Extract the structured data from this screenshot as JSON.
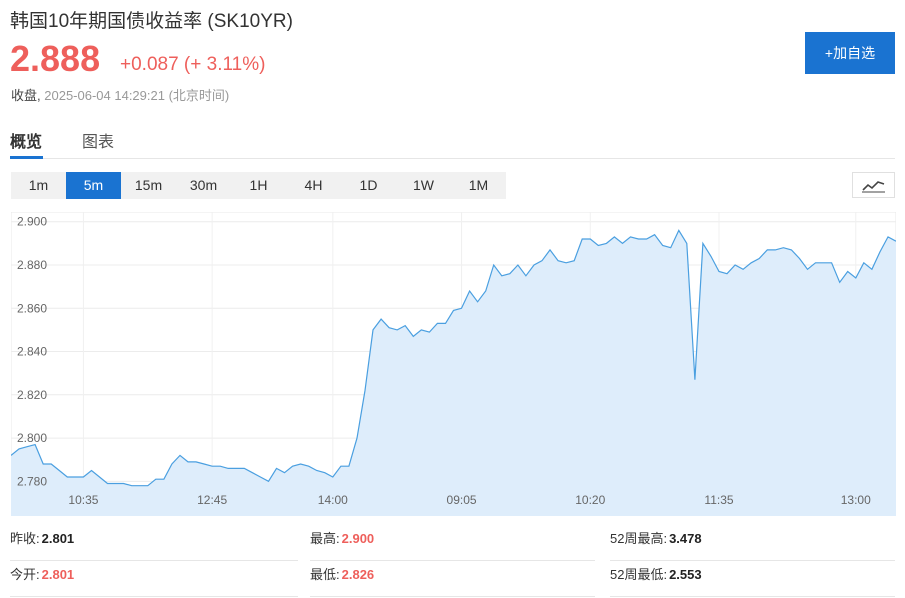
{
  "header": {
    "title": "韩国10年期国债收益率",
    "symbol": "(SK10YR)",
    "price": "2.888",
    "change": "+0.087 (+ 3.11%)",
    "status_label": "收盘,",
    "status_time": "2025-06-04 14:29:21 (北京时间)",
    "add_button": "+加自选",
    "price_color": "#ee5f5b",
    "accent_color": "#1a73d1"
  },
  "tabs": [
    {
      "label": "概览",
      "active": true
    },
    {
      "label": "图表",
      "active": false
    }
  ],
  "periods": [
    {
      "label": "1m",
      "active": false
    },
    {
      "label": "5m",
      "active": true
    },
    {
      "label": "15m",
      "active": false
    },
    {
      "label": "30m",
      "active": false
    },
    {
      "label": "1H",
      "active": false
    },
    {
      "label": "4H",
      "active": false
    },
    {
      "label": "1D",
      "active": false
    },
    {
      "label": "1W",
      "active": false
    },
    {
      "label": "1M",
      "active": false
    }
  ],
  "chart_toggle_icon": "line-chart-icon",
  "chart_data": {
    "type": "area",
    "y_ticks": [
      "2.900",
      "2.880",
      "2.860",
      "2.840",
      "2.820",
      "2.800",
      "2.780"
    ],
    "ylim": [
      2.776,
      2.9045
    ],
    "x_tick_labels": [
      {
        "label": "10:35",
        "index": 9
      },
      {
        "label": "12:45",
        "index": 25
      },
      {
        "label": "14:00",
        "index": 40
      },
      {
        "label": "09:05",
        "index": 56
      },
      {
        "label": "10:20",
        "index": 72
      },
      {
        "label": "11:35",
        "index": 88
      },
      {
        "label": "13:00",
        "index": 105
      }
    ],
    "values": [
      2.792,
      2.795,
      2.796,
      2.797,
      2.788,
      2.788,
      2.785,
      2.782,
      2.782,
      2.782,
      2.785,
      2.782,
      2.779,
      2.779,
      2.779,
      2.778,
      2.778,
      2.778,
      2.781,
      2.781,
      2.788,
      2.792,
      2.789,
      2.789,
      2.788,
      2.787,
      2.787,
      2.786,
      2.786,
      2.786,
      2.784,
      2.782,
      2.78,
      2.786,
      2.784,
      2.787,
      2.788,
      2.787,
      2.785,
      2.784,
      2.782,
      2.787,
      2.787,
      2.8,
      2.822,
      2.85,
      2.855,
      2.851,
      2.85,
      2.852,
      2.847,
      2.85,
      2.849,
      2.853,
      2.853,
      2.859,
      2.86,
      2.868,
      2.863,
      2.868,
      2.88,
      2.875,
      2.876,
      2.88,
      2.875,
      2.88,
      2.882,
      2.887,
      2.882,
      2.881,
      2.882,
      2.892,
      2.892,
      2.889,
      2.89,
      2.893,
      2.89,
      2.893,
      2.892,
      2.892,
      2.894,
      2.889,
      2.888,
      2.896,
      2.89,
      2.827,
      2.89,
      2.884,
      2.877,
      2.876,
      2.88,
      2.878,
      2.881,
      2.883,
      2.887,
      2.887,
      2.888,
      2.887,
      2.883,
      2.878,
      2.881,
      2.881,
      2.881,
      2.872,
      2.877,
      2.874,
      2.881,
      2.878,
      2.886,
      2.893,
      2.891
    ],
    "line_color": "#4a9fe0",
    "fill_color": "#deedfb",
    "grid": true
  },
  "stats": [
    {
      "key": "昨收:",
      "value": "2.801",
      "red": false
    },
    {
      "key": "最高:",
      "value": "2.900",
      "red": true
    },
    {
      "key": "52周最高:",
      "value": "3.478",
      "red": false
    },
    {
      "key": "今开:",
      "value": "2.801",
      "red": true
    },
    {
      "key": "最低:",
      "value": "2.826",
      "red": true
    },
    {
      "key": "52周最低:",
      "value": "2.553",
      "red": false
    }
  ]
}
